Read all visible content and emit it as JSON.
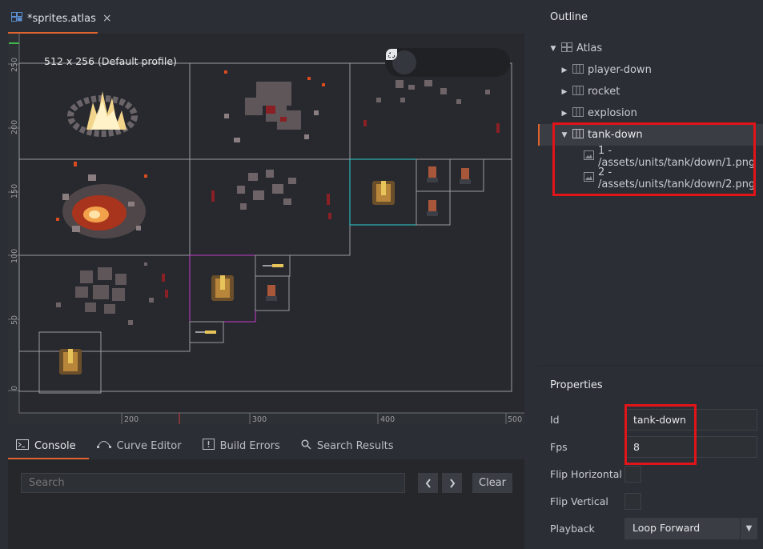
{
  "editor": {
    "tab_title": "*sprites.atlas",
    "tab_close_icon": "×",
    "atlas_size_label": "512 x 256 (Default profile)",
    "toolbar": [
      "move-tool",
      "rotate-tool",
      "scale-tool",
      "rotate-camera-tool"
    ],
    "y_ticks": [
      "250",
      "200",
      "150",
      "100",
      "50",
      "0"
    ],
    "x_ticks": [
      "200",
      "300",
      "400",
      "500"
    ]
  },
  "bottom_panel": {
    "tabs": [
      {
        "label": "Console",
        "icon": "console-icon"
      },
      {
        "label": "Curve Editor",
        "icon": "curve-icon"
      },
      {
        "label": "Build Errors",
        "icon": "error-icon"
      },
      {
        "label": "Search Results",
        "icon": "search-icon"
      }
    ],
    "search_placeholder": "Search",
    "prev_label": "‹",
    "next_label": "›",
    "clear_label": "Clear"
  },
  "outline": {
    "title": "Outline",
    "items": [
      {
        "label": "Atlas",
        "expanded": true
      },
      {
        "label": "player-down",
        "expanded": false
      },
      {
        "label": "rocket",
        "expanded": false
      },
      {
        "label": "explosion",
        "expanded": false
      },
      {
        "label": "tank-down",
        "expanded": true
      },
      {
        "label": "1 - /assets/units/tank/down/1.png"
      },
      {
        "label": "2 - /assets/units/tank/down/2.png"
      }
    ]
  },
  "properties": {
    "title": "Properties",
    "id_label": "Id",
    "id_value": "tank-down",
    "fps_label": "Fps",
    "fps_value": "8",
    "flip_h_label": "Flip Horizontal",
    "flip_v_label": "Flip Vertical",
    "playback_label": "Playback",
    "playback_value": "Loop Forward"
  },
  "colors": {
    "accent": "#e0642e",
    "highlight": "#e11419",
    "selection_cyan": "#2ecfd0",
    "selection_magenta": "#c53ac9"
  }
}
